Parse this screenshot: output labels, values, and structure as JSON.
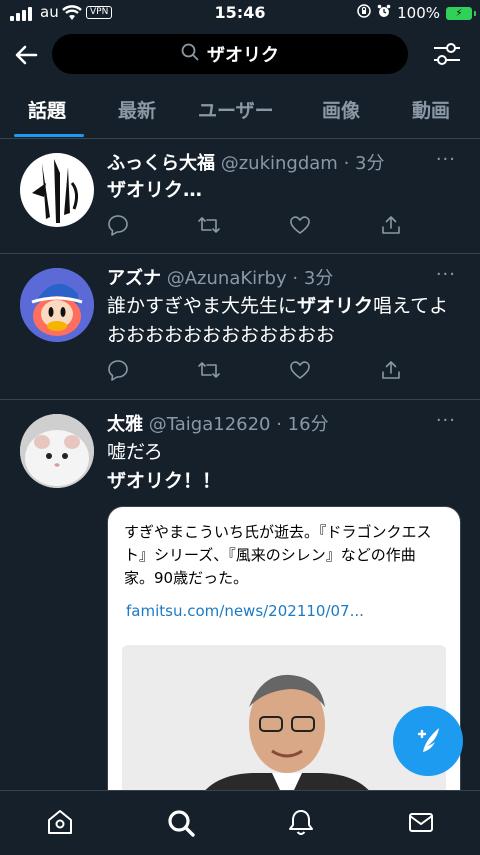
{
  "status": {
    "carrier": "au",
    "vpn": "VPN",
    "time": "15:46",
    "battery": "100%"
  },
  "search": {
    "query": "ザオリク"
  },
  "tabs": [
    {
      "label": "話題",
      "active": true
    },
    {
      "label": "最新"
    },
    {
      "label": "ユーザー"
    },
    {
      "label": "画像"
    },
    {
      "label": "動画"
    }
  ],
  "tweets": [
    {
      "name": "ふっくら大福",
      "handle": "@zukingdam",
      "time": "· 3分",
      "text_bold": "ザオリク…"
    },
    {
      "name": "アズナ",
      "handle": "@AzunaKirby",
      "time": "· 3分",
      "text_pre": "誰かすぎやま大先生に",
      "text_bold": "ザオリク",
      "text_post": "唱えてよおおおおおおおおおおおお"
    },
    {
      "name": "太雅",
      "handle": "@Taiga12620",
      "time": "· 16分",
      "line1": "嘘だろ",
      "text_bold": "ザオリク",
      "text_post": "！！",
      "card": {
        "text": "すぎやまこういち氏が逝去。『ドラゴンクエスト』シリーズ、『風来のシレン』などの作曲家。90歳だった。",
        "link": "famitsu.com/news/202110/07..."
      }
    }
  ],
  "more_label": "···",
  "colors": {
    "background": "#15202b",
    "accent": "#1d9bf0",
    "muted": "#8b98a5"
  },
  "icons": [
    "back-arrow-icon",
    "search-icon",
    "filter-icon",
    "reply-icon",
    "retweet-icon",
    "like-icon",
    "share-icon",
    "compose-icon",
    "home-icon",
    "explore-icon",
    "notifications-icon",
    "messages-icon"
  ]
}
